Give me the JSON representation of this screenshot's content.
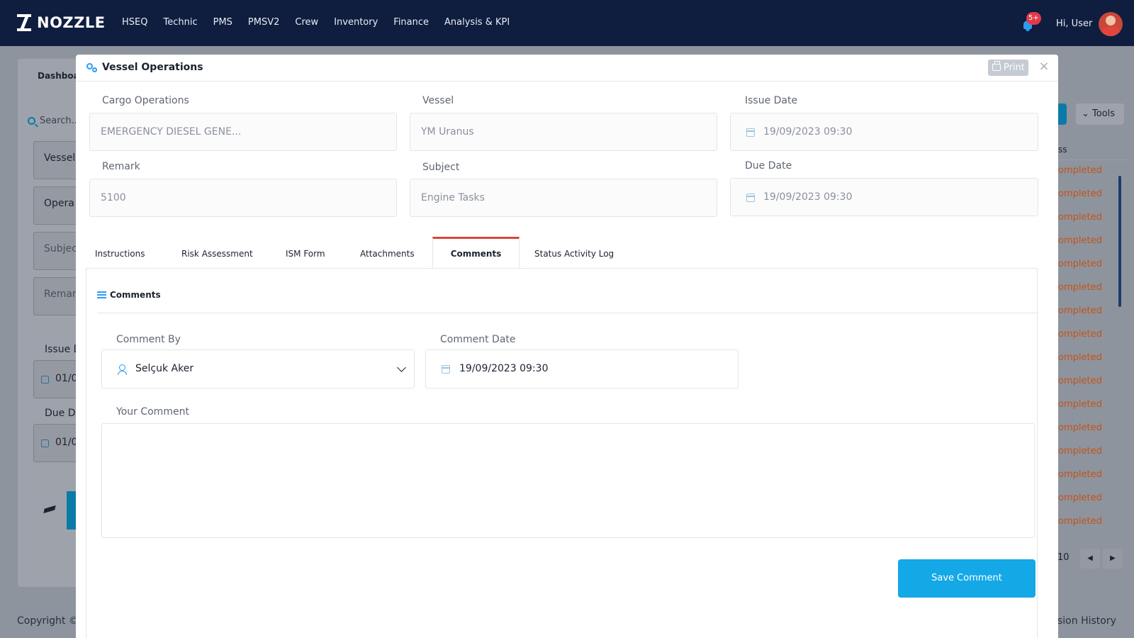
{
  "app": {
    "brand": "NOZZLE"
  },
  "nav": {
    "items": [
      "HSEQ",
      "Technic",
      "PMS",
      "PMSV2",
      "Crew",
      "Inventory",
      "Finance",
      "Analysis & KPI"
    ],
    "notifications_badge": "5+",
    "greeting": "Hi, User"
  },
  "background": {
    "breadcrumb": "Dashboa",
    "search_placeholder": "Search...",
    "fields": [
      "Vessel",
      "Opera",
      "Subjec",
      "Remar"
    ],
    "issue_label": "Issue D",
    "issue_value": "01/0",
    "due_label": "Due Da",
    "due_value": "01/0",
    "tools_label": "Tools",
    "col_header": "ss",
    "status_values": [
      "ompleted",
      "ompleted",
      "ompleted",
      "ompleted",
      "ompleted",
      "ompleted",
      "ompleted",
      "ompleted",
      "ompleted",
      "ompleted",
      "ompleted",
      "ompleted",
      "ompleted",
      "ompleted",
      "ompleted",
      "ompleted"
    ],
    "pagination_num": "10",
    "footer_left": "Copyright ©",
    "footer_right": "sion History"
  },
  "modal": {
    "title": "Vessel Operations",
    "print_label": "Print",
    "close_label": "×",
    "fields": {
      "cargo_label": "Cargo Operations",
      "cargo_value": "EMERGENCY DIESEL GENE...",
      "vessel_label": "Vessel",
      "vessel_value": "YM Uranus",
      "issue_label": "Issue Date",
      "issue_value": "19/09/2023 09:30",
      "remark_label": "Remark",
      "remark_value": "5100",
      "subject_label": "Subject",
      "subject_value": "Engine Tasks",
      "due_label": "Due Date",
      "due_value": "19/09/2023 09:30"
    },
    "tabs": [
      "Instructions",
      "Risk Assessment",
      "ISM Form",
      "Attachments",
      "Comments",
      "Status Activity Log"
    ],
    "active_tab": "Comments",
    "comments": {
      "section_title": "Comments",
      "comment_by_label": "Comment By",
      "comment_by_value": "Selçuk Aker",
      "comment_date_label": "Comment Date",
      "comment_date_value": "19/09/2023 09:30",
      "your_comment_label": "Your Comment",
      "your_comment_value": "",
      "save_label": "Save Comment"
    }
  },
  "colors": {
    "navbar": "#0f1d3f",
    "accent": "#14a8e6",
    "active_tab": "#d9463a",
    "status_text": "#c35316"
  }
}
